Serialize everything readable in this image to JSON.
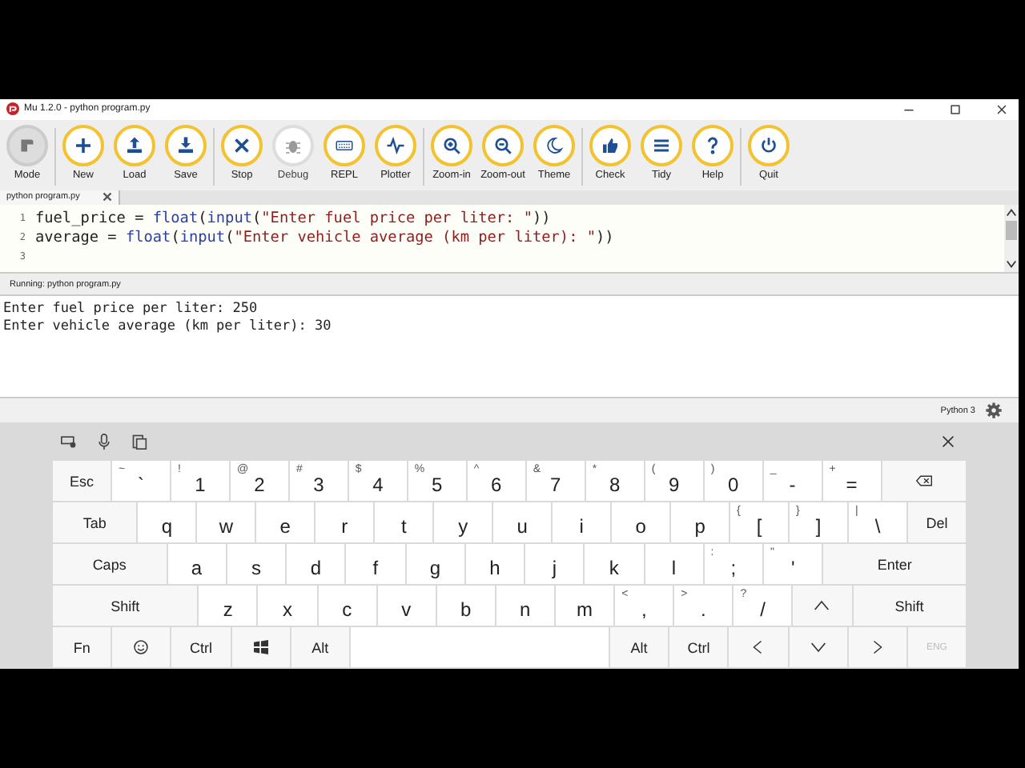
{
  "window": {
    "title": "Mu 1.2.0 - python program.py"
  },
  "toolbar": [
    {
      "label": "Mode",
      "disabled": false
    },
    {
      "label": "New",
      "disabled": false
    },
    {
      "label": "Load",
      "disabled": false
    },
    {
      "label": "Save",
      "disabled": false
    },
    {
      "label": "Stop",
      "disabled": false
    },
    {
      "label": "Debug",
      "disabled": true
    },
    {
      "label": "REPL",
      "disabled": false
    },
    {
      "label": "Plotter",
      "disabled": false
    },
    {
      "label": "Zoom-in",
      "disabled": false
    },
    {
      "label": "Zoom-out",
      "disabled": false
    },
    {
      "label": "Theme",
      "disabled": false
    },
    {
      "label": "Check",
      "disabled": false
    },
    {
      "label": "Tidy",
      "disabled": false
    },
    {
      "label": "Help",
      "disabled": false
    },
    {
      "label": "Quit",
      "disabled": false
    }
  ],
  "tabs": [
    {
      "label": "python program.py",
      "selected": true
    }
  ],
  "editor": {
    "lines": [
      {
        "number": "1",
        "tokens": [
          {
            "kind": "name",
            "text": "fuel_price = "
          },
          {
            "kind": "builtin",
            "text": "float"
          },
          {
            "kind": "name",
            "text": "("
          },
          {
            "kind": "builtin",
            "text": "input"
          },
          {
            "kind": "name",
            "text": "("
          },
          {
            "kind": "string",
            "text": "\"Enter fuel price per liter: \""
          },
          {
            "kind": "name",
            "text": "))"
          }
        ]
      },
      {
        "number": "2",
        "tokens": [
          {
            "kind": "name",
            "text": "average = "
          },
          {
            "kind": "builtin",
            "text": "float"
          },
          {
            "kind": "name",
            "text": "("
          },
          {
            "kind": "builtin",
            "text": "input"
          },
          {
            "kind": "name",
            "text": "("
          },
          {
            "kind": "string",
            "text": "\"Enter vehicle average (km per liter): \""
          },
          {
            "kind": "name",
            "text": "))"
          }
        ]
      },
      {
        "number": "3"
      }
    ]
  },
  "repl": {
    "title": "Running: python program.py",
    "lines": [
      "Enter fuel price per liter: 250",
      "Enter vehicle average (km per liter): 30"
    ]
  },
  "status_bar": {
    "mode": "Python 3"
  },
  "keyboard": {
    "rows": [
      {
        "keys": [
          {
            "kind": "mod",
            "label": "Esc"
          },
          {
            "kind": "char",
            "shift": "~",
            "label": "`"
          },
          {
            "kind": "char",
            "shift": "!",
            "label": "1"
          },
          {
            "kind": "char",
            "shift": "@",
            "label": "2"
          },
          {
            "kind": "char",
            "shift": "#",
            "label": "3"
          },
          {
            "kind": "char",
            "shift": "$",
            "label": "4"
          },
          {
            "kind": "char",
            "shift": "%",
            "label": "5"
          },
          {
            "kind": "char",
            "shift": "^",
            "label": "6"
          },
          {
            "kind": "char",
            "shift": "&",
            "label": "7"
          },
          {
            "kind": "char",
            "shift": "*",
            "label": "8"
          },
          {
            "kind": "char",
            "shift": "(",
            "label": "9"
          },
          {
            "kind": "char",
            "shift": ")",
            "label": "0"
          },
          {
            "kind": "char",
            "shift": "_",
            "label": "-"
          },
          {
            "kind": "char",
            "shift": "+",
            "label": "="
          },
          {
            "kind": "backspace"
          }
        ]
      },
      {
        "keys": [
          {
            "kind": "mod",
            "label": "Tab"
          },
          {
            "kind": "char",
            "label": "q"
          },
          {
            "kind": "char",
            "label": "w"
          },
          {
            "kind": "char",
            "label": "e"
          },
          {
            "kind": "char",
            "label": "r"
          },
          {
            "kind": "char",
            "label": "t"
          },
          {
            "kind": "char",
            "label": "y"
          },
          {
            "kind": "char",
            "label": "u"
          },
          {
            "kind": "char",
            "label": "i"
          },
          {
            "kind": "char",
            "label": "o"
          },
          {
            "kind": "char",
            "label": "p"
          },
          {
            "kind": "char",
            "shift": "{",
            "label": "["
          },
          {
            "kind": "char",
            "shift": "}",
            "label": "]"
          },
          {
            "kind": "char",
            "shift": "|",
            "label": "\\"
          },
          {
            "kind": "mod",
            "label": "Del"
          }
        ]
      },
      {
        "keys": [
          {
            "kind": "mod",
            "label": "Caps"
          },
          {
            "kind": "char",
            "label": "a"
          },
          {
            "kind": "char",
            "label": "s"
          },
          {
            "kind": "char",
            "label": "d"
          },
          {
            "kind": "char",
            "label": "f"
          },
          {
            "kind": "char",
            "label": "g"
          },
          {
            "kind": "char",
            "label": "h"
          },
          {
            "kind": "char",
            "label": "j"
          },
          {
            "kind": "char",
            "label": "k"
          },
          {
            "kind": "char",
            "label": "l"
          },
          {
            "kind": "char",
            "shift": ":",
            "label": ";"
          },
          {
            "kind": "char",
            "shift": "\"",
            "label": "'"
          },
          {
            "kind": "mod",
            "label": "Enter"
          }
        ]
      },
      {
        "keys": [
          {
            "kind": "mod",
            "label": "Shift"
          },
          {
            "kind": "char",
            "label": "z"
          },
          {
            "kind": "char",
            "label": "x"
          },
          {
            "kind": "char",
            "label": "c"
          },
          {
            "kind": "char",
            "label": "v"
          },
          {
            "kind": "char",
            "label": "b"
          },
          {
            "kind": "char",
            "label": "n"
          },
          {
            "kind": "char",
            "label": "m"
          },
          {
            "kind": "char",
            "shift": "<",
            "label": ","
          },
          {
            "kind": "char",
            "shift": ">",
            "label": "."
          },
          {
            "kind": "char",
            "shift": "?",
            "label": "/"
          },
          {
            "kind": "arrow-up"
          },
          {
            "kind": "mod",
            "label": "Shift"
          }
        ]
      },
      {
        "keys": [
          {
            "kind": "mod",
            "label": "Fn"
          },
          {
            "kind": "emoji"
          },
          {
            "kind": "mod",
            "label": "Ctrl"
          },
          {
            "kind": "windows"
          },
          {
            "kind": "mod",
            "label": "Alt"
          },
          {
            "kind": "space"
          },
          {
            "kind": "mod",
            "label": "Alt"
          },
          {
            "kind": "mod",
            "label": "Ctrl"
          },
          {
            "kind": "arrow-left"
          },
          {
            "kind": "arrow-down"
          },
          {
            "kind": "arrow-right"
          },
          {
            "kind": "disabled",
            "label": "ENG"
          }
        ]
      }
    ]
  }
}
